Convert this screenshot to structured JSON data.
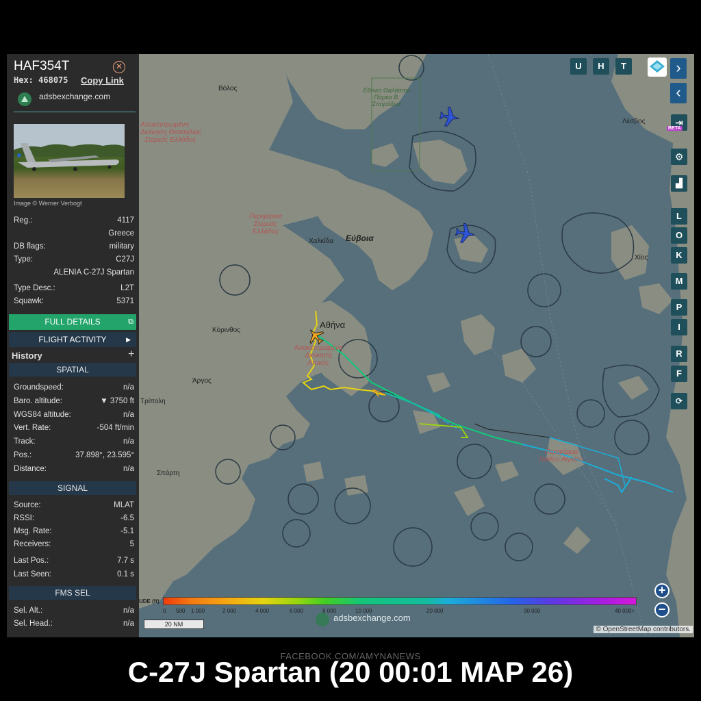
{
  "sidebar": {
    "callsign": "HAF354T",
    "hex_label": "Hex:",
    "hex_value": "468075",
    "copy_link": "Copy Link",
    "source_name": "adsbexchange.com",
    "image_credit": "Image © Werner Verbogt",
    "info": [
      {
        "key": "Reg.:",
        "value": "4117"
      },
      {
        "key": "",
        "value": "Greece"
      },
      {
        "key": "DB flags:",
        "value": "military"
      },
      {
        "key": "Type:",
        "value": "C27J"
      },
      {
        "key": "",
        "value": "ALENIA C-27J Spartan"
      },
      {
        "key": "Type Desc.:",
        "value": "L2T"
      },
      {
        "key": "Squawk:",
        "value": "5371"
      }
    ],
    "full_details": "FULL DETAILS",
    "flight_activity": "FLIGHT ACTIVITY",
    "history": "History",
    "spatial_header": "SPATIAL",
    "spatial": [
      {
        "key": "Groundspeed:",
        "value": "n/a"
      },
      {
        "key": "Baro. altitude:",
        "value": "▼ 3750 ft"
      },
      {
        "key": "WGS84 altitude:",
        "value": "n/a"
      },
      {
        "key": "Vert. Rate:",
        "value": "-504 ft/min"
      },
      {
        "key": "Track:",
        "value": "n/a"
      },
      {
        "key": "Pos.:",
        "value": "37.898°, 23.595°"
      },
      {
        "key": "Distance:",
        "value": "n/a"
      }
    ],
    "signal_header": "SIGNAL",
    "signal": [
      {
        "key": "Source:",
        "value": "MLAT"
      },
      {
        "key": "RSSI:",
        "value": "-6.5"
      },
      {
        "key": "Msg. Rate:",
        "value": "-5.1"
      },
      {
        "key": "Receivers:",
        "value": "5"
      },
      {
        "key": "Last Pos.:",
        "value": "7.7 s"
      },
      {
        "key": "Last Seen:",
        "value": "0.1 s"
      }
    ],
    "fms_header": "FMS SEL",
    "fms": [
      {
        "key": "Sel. Alt.:",
        "value": "n/a"
      },
      {
        "key": "Sel. Head.:",
        "value": "n/a"
      }
    ]
  },
  "map": {
    "labels": {
      "volos": "Βόλος",
      "athina": "Αθήνα",
      "chalkida": "Χαλκίδα",
      "evia": "Εύβοια",
      "korinthos": "Κόρινθος",
      "argos": "Άργος",
      "tripoli": "Τρίπολη",
      "sparti": "Σπάρτη",
      "lesvos": "Λέσβος",
      "chios": "Χίος",
      "park": "Εθνικό Θαλάσσιο Πάρκο Β. Σποράδων",
      "region_thessaly": "Αποκεντρωμένη Διοίκηση Θεσσαλίας - Στερεάς Ελλάδος",
      "region_sterea": "Περιφέρεια Στερεάς Ελλάδας",
      "region_attica": "Αποκεντρωμένη Διοίκηση Αττικής",
      "region_south_aegean": "Περιφέρεια Νοτίου Αιγαίου"
    },
    "top_buttons": [
      "U",
      "H",
      "T"
    ],
    "right_buttons": [
      "L",
      "O",
      "K",
      "M",
      "P",
      "I",
      "R",
      "F"
    ],
    "beta": "BETA",
    "altitude_label": "UDE (ft)",
    "altitude_ticks": [
      "0",
      "500",
      "1 000",
      "2 000",
      "4 000",
      "6 000",
      "8 000",
      "10 000",
      "20 000",
      "30 000",
      "40 000+"
    ],
    "scale": "20 NM",
    "watermark": "adsbexchange.com",
    "attribution": "© OpenStreetMap contributors.",
    "zoom_in": "+",
    "zoom_out": "−",
    "colors": {
      "track_low": "#e6d311",
      "track_mid": "#14c57a",
      "track_high": "#1baed8",
      "aircraft_selected": "#f5a623",
      "aircraft_other": "#2f55d4",
      "land": "#8a8d82",
      "sea": "#566f7b"
    }
  },
  "footer": {
    "facebook": "FACEBOOK.COM/AMYNANEWS",
    "caption": "C-27J Spartan (20 00:01 MAP 26)"
  }
}
